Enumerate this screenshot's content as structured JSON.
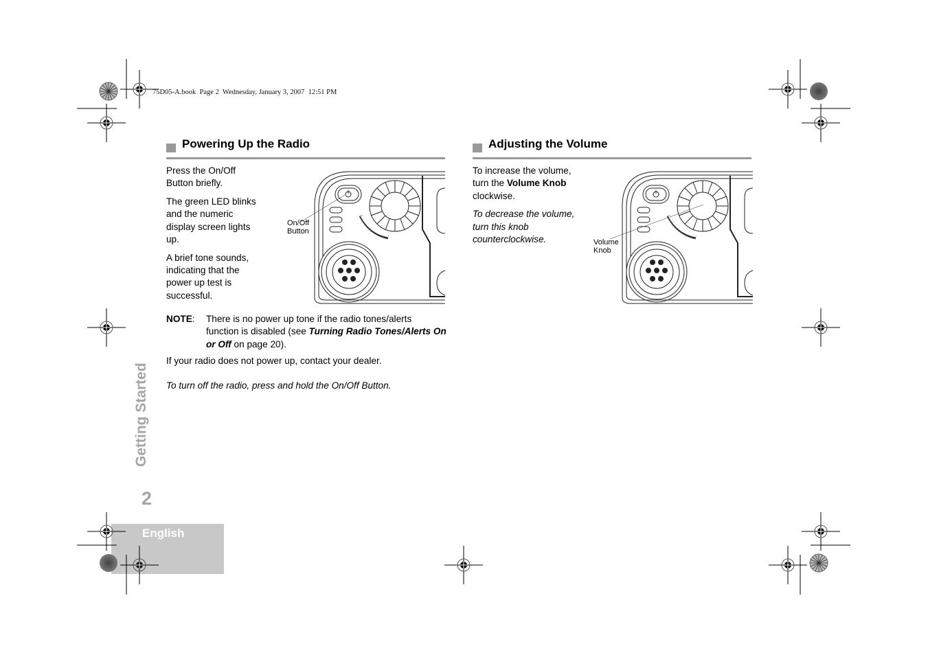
{
  "header": {
    "running_head": "75D05-A.book  Page 2  Wednesday, January 3, 2007  12:51 PM"
  },
  "sections": [
    {
      "title": "Powering Up the Radio",
      "paragraphs": [
        "Press the On/Off Button briefly.",
        "The green LED blinks and the numeric display screen lights up.",
        "A brief tone sounds, indicating that the power up test is successful."
      ],
      "figure": {
        "callout_line1": "On/Off",
        "callout_line2": "Button",
        "icon": "radio-front-panel"
      },
      "note": {
        "label": "NOTE",
        "colon": ":",
        "text_before": "There is no power up tone if the radio tones/alerts function is disabled (see ",
        "link_text": "Turning Radio Tones/Alerts On or Off",
        "text_after": " on page 20)."
      },
      "after_note": "If your radio does not power up, contact your dealer.",
      "italic_tip": "To turn off the radio, press and hold the On/Off Button."
    },
    {
      "title": "Adjusting the Volume",
      "para1_before": "To increase the volume, turn the ",
      "para1_bold": "Volume Knob",
      "para1_after": " clockwise.",
      "italic_para": "To decrease the volume, turn this knob counterclockwise.",
      "figure": {
        "callout_line1": "Volume",
        "callout_line2": "Knob",
        "icon": "radio-front-panel"
      }
    }
  ],
  "side_tab": "Getting Started",
  "page_number": "2",
  "language_tab": "English",
  "colors": {
    "heading_gray": "#999999",
    "tab_text_gray": "#a6a6a6",
    "language_box": "#c8c8c8"
  }
}
